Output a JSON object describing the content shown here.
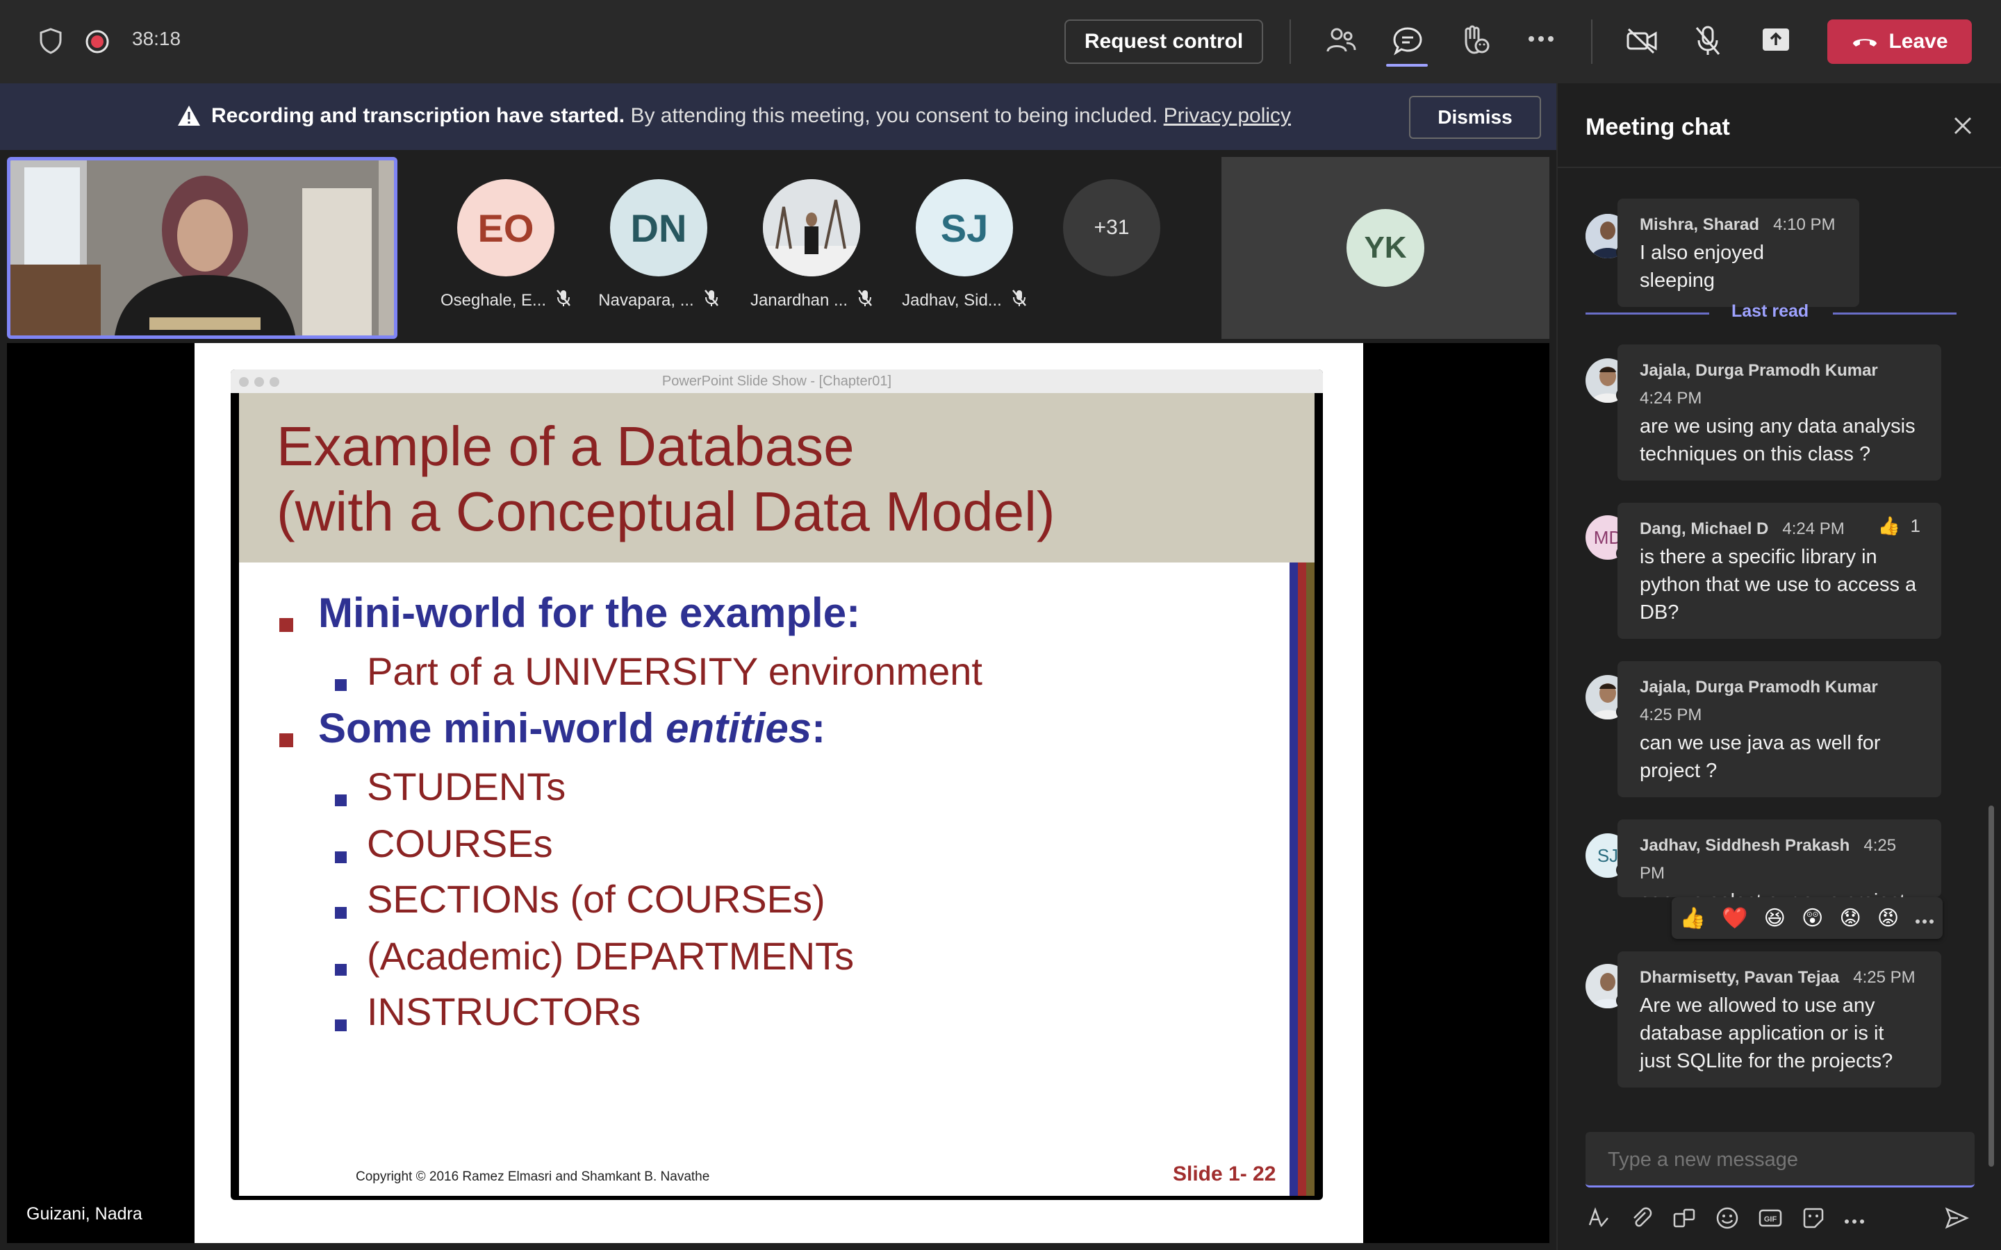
{
  "topbar": {
    "timer": "38:18",
    "request_control_label": "Request control",
    "leave_label": "Leave",
    "colors": {
      "leave_bg": "#c4314b",
      "active_tab": "#9ea2ff",
      "recording_dot": "#e04050"
    }
  },
  "banner": {
    "bold_text": "Recording and transcription have started.",
    "text": " By attending this meeting, you consent to being included.",
    "link_text": "Privacy policy",
    "dismiss_label": "Dismiss"
  },
  "participants": [
    {
      "initials": "EO",
      "name": "Oseghale, E...",
      "bg": "#f8d9d2",
      "fg": "#a33e2b"
    },
    {
      "initials": "DN",
      "name": "Navapara, ...",
      "bg": "#d6e6ea",
      "fg": "#27575f"
    },
    {
      "initials": "",
      "name": "Janardhan ...",
      "bg": "#d9d9d9",
      "fg": "#333333"
    },
    {
      "initials": "SJ",
      "name": "Jadhav, Sid...",
      "bg": "#e1eff4",
      "fg": "#2b6d80"
    }
  ],
  "overflow_count": "+31",
  "spotlight_initials": "YK",
  "presenter_name": "Guizani, Nadra",
  "slide": {
    "window_title": "PowerPoint Slide Show - [Chapter01]",
    "title_line1": "Example of a Database",
    "title_line2": "(with a Conceptual Data Model)",
    "bullet1": "Mini-world for the example:",
    "bullet1_sub": "Part of a UNIVERSITY environment",
    "bullet2_pre": "Some mini-world ",
    "bullet2_em": "entities",
    "bullet2_post": ":",
    "entities": [
      "STUDENTs",
      "COURSEs",
      "SECTIONs (of COURSEs)",
      "(Academic) DEPARTMENTs",
      "INSTRUCTORs"
    ],
    "copyright": "Copyright © 2016 Ramez Elmasri and Shamkant B. Navathe",
    "slide_number": "Slide 1- 22"
  },
  "chat": {
    "title": "Meeting chat",
    "last_read_label": "Last read",
    "messages": [
      {
        "sender": "Mishra, Sharad",
        "time": "4:10 PM",
        "body": "I also enjoyed sleeping"
      },
      {
        "sender": "Jajala, Durga Pramodh Kumar",
        "time": "4:24 PM",
        "body": "are we using any data analysis techniques on this class ?"
      },
      {
        "sender": "Dang, Michael D",
        "time": "4:24 PM",
        "initials": "MD",
        "reaction": "👍",
        "reaction_count": "1",
        "body": "is there a specific library in python that we use to access a DB?"
      },
      {
        "sender": "Jajala, Durga Pramodh Kumar",
        "time": "4:25 PM",
        "body": "can we use java as well for project ?"
      },
      {
        "sender": "Jadhav, Siddhesh Prakash",
        "time": "4:25 PM",
        "initials": "SJ",
        "body": "can we select our own project topic?"
      },
      {
        "sender": "Dharmisetty, Pavan Tejaa",
        "time": "4:25 PM",
        "body": "Are we allowed to use any database application or is it just SQLlite for the projects?"
      }
    ],
    "reactions": [
      "👍",
      "❤️",
      "😆",
      "😲",
      "😟",
      "😡"
    ],
    "compose_placeholder": "Type a new message"
  }
}
